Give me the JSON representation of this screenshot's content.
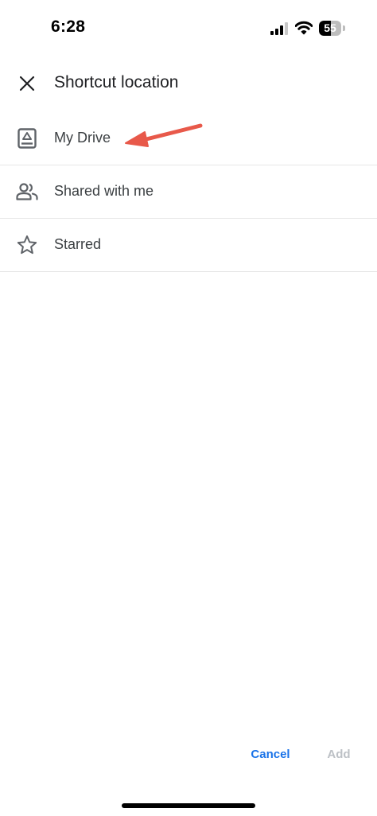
{
  "status_bar": {
    "time": "6:28",
    "battery_level": "55",
    "battery_fraction": 0.55,
    "icons": [
      "signal-icon",
      "wifi-icon",
      "battery-icon"
    ]
  },
  "header": {
    "title": "Shortcut location",
    "close_icon": "close-icon"
  },
  "locations": [
    {
      "label": "My Drive",
      "icon": "my-drive-icon"
    },
    {
      "label": "Shared with me",
      "icon": "people-icon"
    },
    {
      "label": "Starred",
      "icon": "star-icon"
    }
  ],
  "annotation": {
    "color": "#e8594a",
    "target": "My Drive"
  },
  "footer": {
    "cancel_label": "Cancel",
    "add_label": "Add",
    "accent_color": "#1a73e8",
    "disabled_color": "#bdc1c6"
  }
}
